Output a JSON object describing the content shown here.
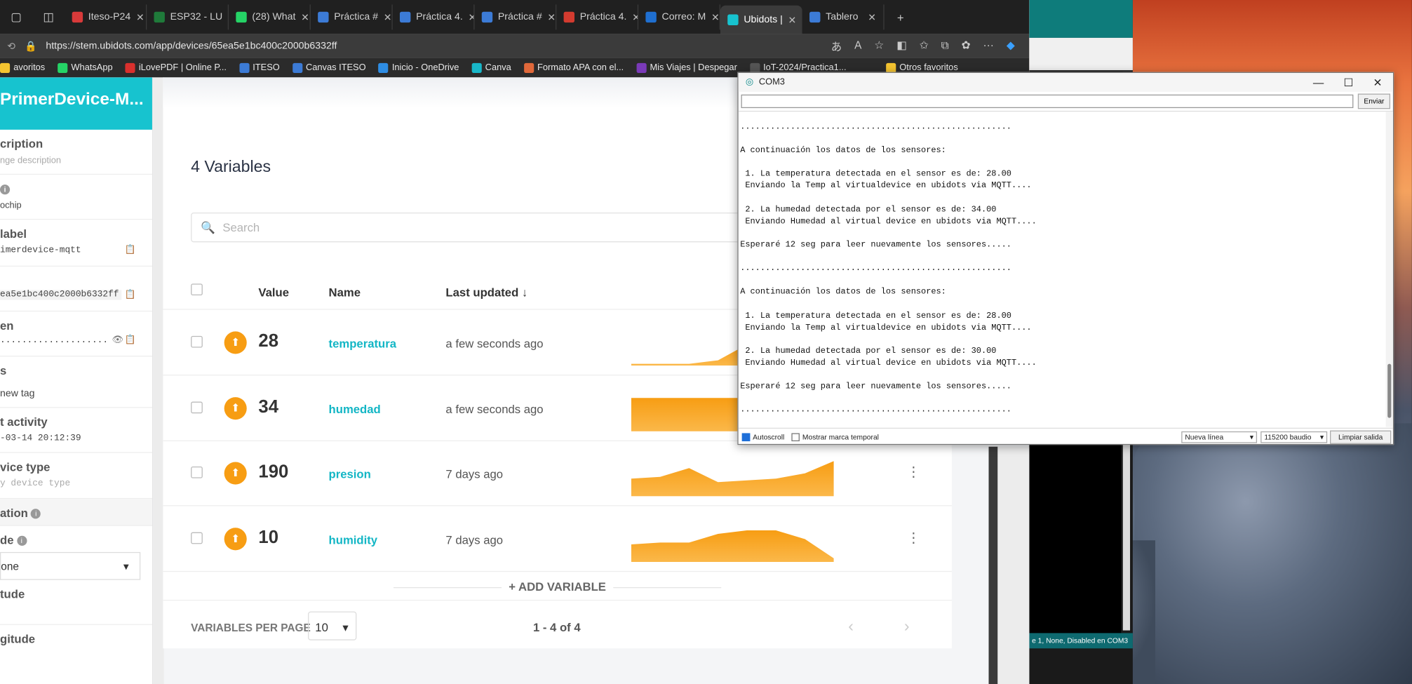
{
  "tabs": [
    {
      "label": "Iteso-P24",
      "color": "#d83a3a"
    },
    {
      "label": "ESP32 - LU",
      "color": "#1f7a3a"
    },
    {
      "label": "(28) What",
      "color": "#25d366"
    },
    {
      "label": "Práctica #",
      "color": "#3c7bd6"
    },
    {
      "label": "Práctica 4.",
      "color": "#3c7bd6"
    },
    {
      "label": "Práctica #",
      "color": "#3c7bd6"
    },
    {
      "label": "Práctica 4.",
      "color": "#d33b2f"
    },
    {
      "label": "Correo: M",
      "color": "#1f6fd0"
    },
    {
      "label": "Ubidots |",
      "color": "#17c3cf"
    },
    {
      "label": "Tablero",
      "color": "#3c7bd6"
    }
  ],
  "address": {
    "url": "https://stem.ubidots.com/app/devices/65ea5e1bc400c2000b6332ff"
  },
  "bookmarks": [
    {
      "label": "avoritos",
      "color": "#f4c430"
    },
    {
      "label": "WhatsApp",
      "color": "#25d366"
    },
    {
      "label": "iLovePDF | Online P...",
      "color": "#d9302d"
    },
    {
      "label": "ITESO",
      "color": "#3c7bd6"
    },
    {
      "label": "Canvas ITESO",
      "color": "#3c7bd6"
    },
    {
      "label": "Inicio - OneDrive",
      "color": "#2e8de4"
    },
    {
      "label": "Canva",
      "color": "#18b7c9"
    },
    {
      "label": "Formato APA con el...",
      "color": "#e0683a"
    },
    {
      "label": "Mis Viajes | Despegar",
      "color": "#7a3ab8"
    },
    {
      "label": "IoT-2024/Practica1...",
      "color": "#555"
    },
    {
      "label": "Otros favoritos",
      "color": "#f4c430"
    }
  ],
  "device": {
    "name": "PrimerDevice-M...",
    "desc_label": "cription",
    "desc_placeholder": "nge description",
    "field_a": "ochip",
    "api_label": "label",
    "api_value": "imerdevice-mqtt",
    "id_value": "ea5e1bc400c2000b6332ff",
    "token_label": "en",
    "token_value": "····················",
    "tags_label": "s",
    "tags_value": "new tag",
    "activity_label": "t activity",
    "activity_value": "-03-14 20:12:39",
    "type_label": "vice type",
    "type_value": "y device type",
    "location_label": "ation",
    "mode_label": "de",
    "mode_value": "one",
    "lat_label": "tude",
    "lng_label": "gitude"
  },
  "variables": {
    "title": "4 Variables",
    "search_placeholder": "Search",
    "headers": {
      "value": "Value",
      "name": "Name",
      "updated": "Last updated ↓"
    },
    "rows": [
      {
        "value": "28",
        "name": "temperatura",
        "updated": "a few seconds ago",
        "spark": [
          0,
          0,
          0,
          0.1,
          0.55,
          0.55,
          0.55,
          0.55
        ]
      },
      {
        "value": "34",
        "name": "humedad",
        "updated": "a few seconds ago",
        "spark": [
          0.9,
          0.9,
          0.9,
          0.9,
          0.9,
          0.9,
          0.9,
          0.9
        ]
      },
      {
        "value": "190",
        "name": "presion",
        "updated": "7 days ago",
        "spark": [
          0.45,
          0.5,
          0.75,
          0.35,
          0.4,
          0.45,
          0.6,
          0.95
        ]
      },
      {
        "value": "10",
        "name": "humidity",
        "updated": "7 days ago",
        "spark": [
          0.45,
          0.5,
          0.5,
          0.75,
          0.85,
          0.85,
          0.6,
          0.05
        ]
      }
    ],
    "add_label": "+ ADD VARIABLE",
    "per_page_label": "VARIABLES PER PAGE",
    "per_page_value": "10",
    "pager": "1 - 4 of 4"
  },
  "com": {
    "title": "COM3",
    "send_label": "Enviar",
    "output": "......................................................\n\nA continuación los datos de los sensores:\n\n 1. La temperatura detectada en el sensor es de: 28.00\n Enviando la Temp al virtualdevice en ubidots via MQTT....\n\n 2. La humedad detectada por el sensor es de: 34.00\n Enviando Humedad al virtual device en ubidots via MQTT....\n\nEsperaré 12 seg para leer nuevamente los sensores.....\n\n......................................................\n\nA continuación los datos de los sensores:\n\n 1. La temperatura detectada en el sensor es de: 28.00\n Enviando la Temp al virtualdevice en ubidots via MQTT....\n\n 2. La humedad detectada por el sensor es de: 30.00\n Enviando Humedad al virtual device en ubidots via MQTT....\n\nEsperaré 12 seg para leer nuevamente los sensores.....\n\n......................................................",
    "autoscroll": "Autoscroll",
    "timestamp": "Mostrar marca temporal",
    "line_ending": "Nueva línea",
    "baud": "115200 baudio",
    "clear": "Limpiar salida"
  },
  "bgwin_status": "e 1, None, Disabled en COM3",
  "accent": "#17c3cf",
  "orange": "#f79d13"
}
